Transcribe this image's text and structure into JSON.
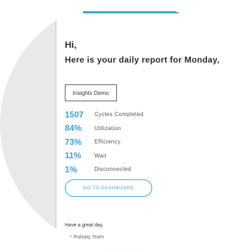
{
  "email": {
    "greeting": "Hi,",
    "subtitle": "Here is your daily report for Monday, ",
    "account_name": "Insights Demo",
    "stats": [
      {
        "value": "1507",
        "label": "Cycles Completed"
      },
      {
        "value": "84%",
        "label": "Utilization"
      },
      {
        "value": "73%",
        "label": "Efficiency"
      },
      {
        "value": "11%",
        "label": "Wait"
      },
      {
        "value": "1%",
        "label": "Disconnected"
      }
    ],
    "dashboard_button": "GO TO DASHBOARD",
    "signoff": "Have a great day,",
    "team": "our Robotiq Team"
  },
  "colors": {
    "accent": "#3aa2dc",
    "text": "#2b2b2b"
  }
}
